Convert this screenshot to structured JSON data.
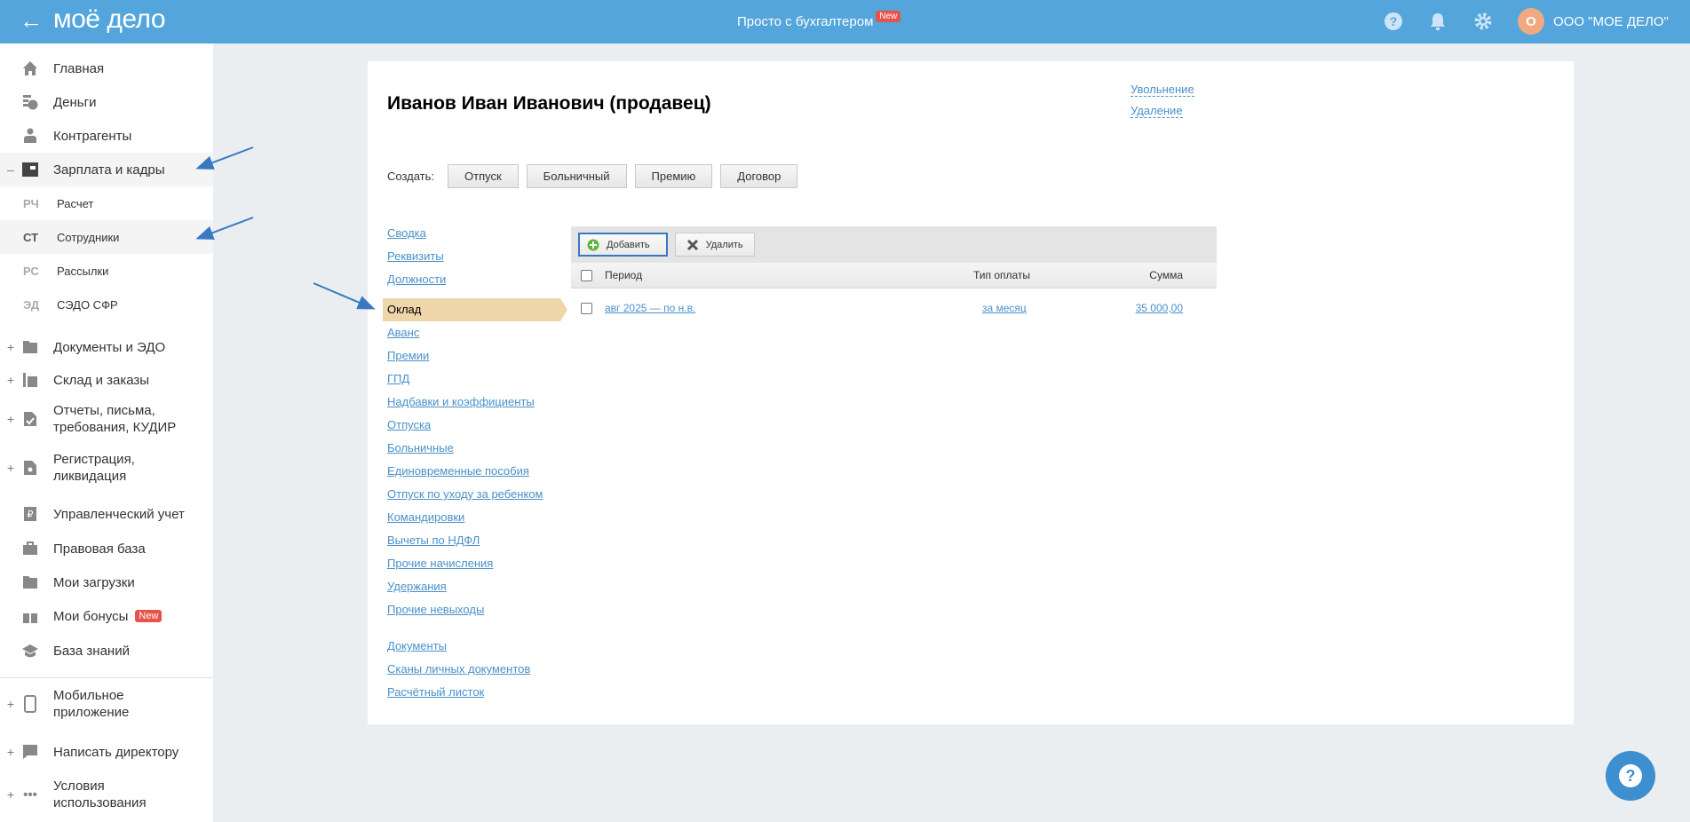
{
  "header": {
    "logo": "моё дело",
    "title": "Просто с бухгалтером",
    "title_badge": "New",
    "avatar_letter": "О",
    "org": "ООО \"МОЕ ДЕЛО\""
  },
  "sidebar": {
    "items": [
      {
        "label": "Главная",
        "icon": "home-icon"
      },
      {
        "label": "Деньги",
        "icon": "money-icon"
      },
      {
        "label": "Контрагенты",
        "icon": "contractor-icon"
      },
      {
        "label": "Зарплата и кадры",
        "icon": "wallet-icon",
        "toggle": "–"
      },
      {
        "abbr": "РЧ",
        "label": "Расчет"
      },
      {
        "abbr": "СТ",
        "label": "Сотрудники"
      },
      {
        "abbr": "РС",
        "label": "Рассылки"
      },
      {
        "abbr": "ЭД",
        "label": "СЭДО СФР"
      },
      {
        "label": "Документы и ЭДО",
        "icon": "folder-icon",
        "toggle": "+"
      },
      {
        "label": "Склад и заказы",
        "icon": "warehouse-icon",
        "toggle": "+"
      },
      {
        "label": "Отчеты, письма, требования, КУДИР",
        "icon": "report-icon",
        "toggle": "+"
      },
      {
        "label": "Регистрация, ликвидация",
        "icon": "registration-icon",
        "toggle": "+"
      },
      {
        "label": "Управленческий учет",
        "icon": "ruble-doc-icon"
      },
      {
        "label": "Правовая база",
        "icon": "briefcase-icon"
      },
      {
        "label": "Мои загрузки",
        "icon": "folder-icon"
      },
      {
        "label": "Мои бонусы",
        "icon": "gift-icon",
        "badge": "New"
      },
      {
        "label": "База знаний",
        "icon": "graduation-icon"
      },
      {
        "label": "Мобильное приложение",
        "icon": "mobile-icon",
        "toggle": "+"
      },
      {
        "label": "Написать директору",
        "icon": "chat-icon",
        "toggle": "+"
      },
      {
        "label": "Условия использования",
        "icon": "more-icon",
        "toggle": "+"
      }
    ]
  },
  "main": {
    "title": "Иванов Иван Иванович (продавец)",
    "dismiss": "Увольнение",
    "delete": "Удаление",
    "create_label": "Создать:",
    "create_buttons": [
      "Отпуск",
      "Больничный",
      "Премию",
      "Договор"
    ],
    "nav": [
      "Сводка",
      "Реквизиты",
      "Должности",
      "Оклад",
      "Аванс",
      "Премии",
      "ГПД",
      "Надбавки и коэффициенты",
      "Отпуска",
      "Больничные",
      "Единовременные пособия",
      "Отпуск по уходу за ребенком",
      "Командировки",
      "Вычеты по НДФЛ",
      "Прочие начисления",
      "Удержания",
      "Прочие невыходы",
      "Документы",
      "Сканы личных документов",
      "Расчётный листок"
    ],
    "table": {
      "add": "Добавить",
      "remove": "Удалить",
      "columns": [
        "Период",
        "Тип оплаты",
        "Сумма"
      ],
      "rows": [
        {
          "period": "авг 2025 — по н.в.",
          "type": "за месяц",
          "sum": "35 000,00"
        }
      ]
    }
  }
}
